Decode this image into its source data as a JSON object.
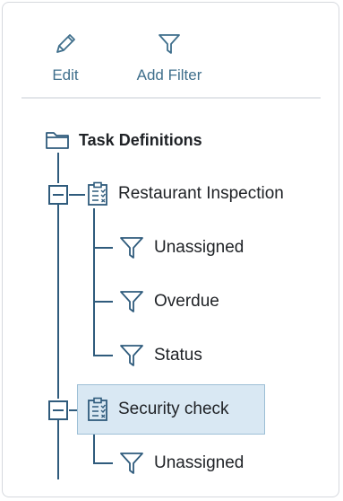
{
  "toolbar": {
    "edit_label": "Edit",
    "add_filter_label": "Add Filter"
  },
  "tree": {
    "root": {
      "label": "Task Definitions",
      "icon": "folder-icon"
    },
    "definitions": [
      {
        "label": "Restaurant Inspection",
        "icon": "checklist-icon",
        "expanded": true,
        "filters": [
          "Unassigned",
          "Overdue",
          "Status"
        ]
      },
      {
        "label": "Security check",
        "icon": "checklist-icon",
        "expanded": true,
        "selected": true,
        "filters": [
          "Unassigned"
        ]
      }
    ]
  },
  "colors": {
    "accent": "#3f6f8c",
    "tree_line": "#2f5b7c",
    "selection_bg": "#d9e8f3",
    "selection_border": "#9dbfd6"
  }
}
